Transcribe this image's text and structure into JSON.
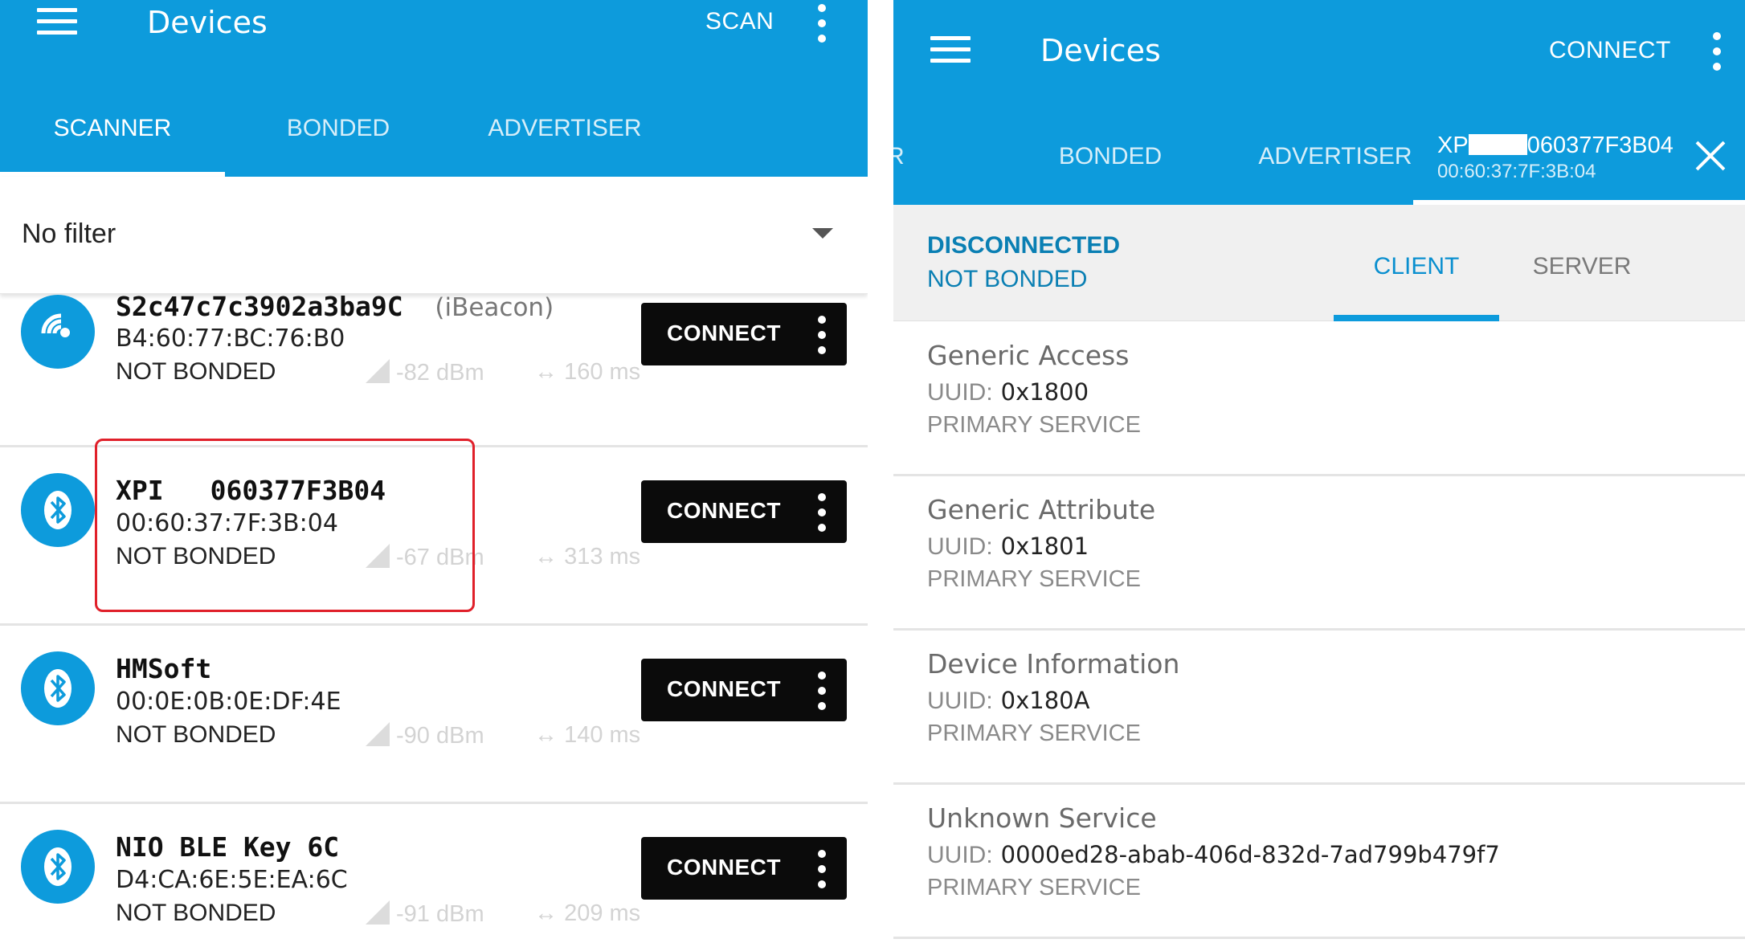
{
  "left": {
    "appbar": {
      "title": "Devices",
      "action": "SCAN"
    },
    "tabs": [
      {
        "label": "SCANNER",
        "active": true
      },
      {
        "label": "BONDED",
        "active": false
      },
      {
        "label": "ADVERTISER",
        "active": false
      }
    ],
    "filter": {
      "value": "No filter"
    },
    "devices": [
      {
        "name": "S2c47c7c3902a3ba9C",
        "type": "(iBeacon)",
        "mac": "B4:60:77:BC:76:B0",
        "bond": "NOT BONDED",
        "rssi": "-82 dBm",
        "interval": "160 ms",
        "icon": "beacon-icon",
        "button": "CONNECT"
      },
      {
        "name_prefix": "XPI",
        "name_suffix": "060377F3B04",
        "mac": "00:60:37:7F:3B:04",
        "bond": "NOT BONDED",
        "rssi": "-67 dBm",
        "interval": "313 ms",
        "icon": "bluetooth-icon",
        "button": "CONNECT"
      },
      {
        "name": "HMSoft",
        "mac": "00:0E:0B:0E:DF:4E",
        "bond": "NOT BONDED",
        "rssi": "-90 dBm",
        "interval": "140 ms",
        "icon": "bluetooth-icon",
        "button": "CONNECT"
      },
      {
        "name": "NIO BLE Key 6C",
        "mac": "D4:CA:6E:5E:EA:6C",
        "bond": "NOT BONDED",
        "rssi": "-91 dBm",
        "interval": "209 ms",
        "icon": "bluetooth-icon",
        "button": "CONNECT"
      }
    ]
  },
  "right": {
    "appbar": {
      "title": "Devices",
      "action": "CONNECT"
    },
    "tabs": [
      {
        "label": "R"
      },
      {
        "label": "BONDED"
      },
      {
        "label": "ADVERTISER"
      }
    ],
    "device_tab": {
      "name_prefix": "XP",
      "name_suffix": "060377F3B04",
      "mac": "00:60:37:7F:3B:04"
    },
    "status": {
      "connection": "DISCONNECTED",
      "bond": "NOT BONDED"
    },
    "subtabs": [
      {
        "label": "CLIENT",
        "active": true
      },
      {
        "label": "SERVER",
        "active": false
      }
    ],
    "uuid_label": "UUID:",
    "services": [
      {
        "name": "Generic Access",
        "uuid": "0x1800",
        "type": "PRIMARY SERVICE"
      },
      {
        "name": "Generic Attribute",
        "uuid": "0x1801",
        "type": "PRIMARY SERVICE"
      },
      {
        "name": "Device Information",
        "uuid": "0x180A",
        "type": "PRIMARY SERVICE"
      },
      {
        "name": "Unknown Service",
        "uuid": "0000ed28-abab-406d-832d-7ad799b479f7",
        "type": "PRIMARY SERVICE"
      }
    ]
  },
  "colors": {
    "primary": "#0d9bdc",
    "accent": "#0a8fcf",
    "highlight": "#e0202a"
  }
}
